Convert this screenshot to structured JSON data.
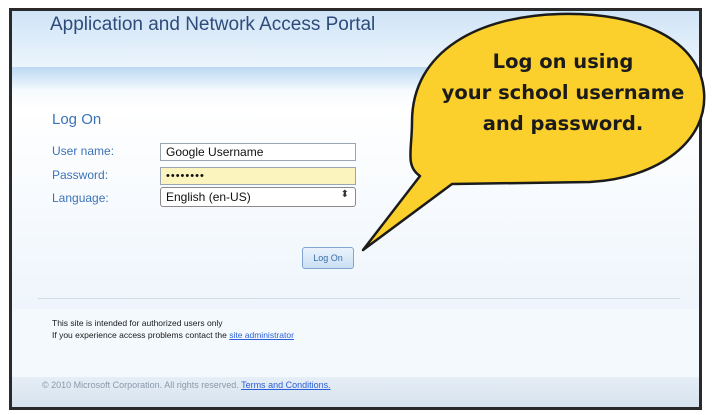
{
  "portal": {
    "title": "Application and Network Access Portal"
  },
  "form": {
    "heading": "Log On",
    "username_label": "User name:",
    "username_value": "Google Username",
    "password_label": "Password:",
    "password_value": "••••••••",
    "language_label": "Language:",
    "language_value": "English (en-US)",
    "submit_label": "Log On"
  },
  "notice": {
    "line1": "This site is intended for authorized users only",
    "line2_prefix": "If you experience access problems contact the ",
    "admin_link": "site administrator"
  },
  "footer": {
    "copyright": "© 2010 Microsoft Corporation. All rights reserved.",
    "terms_link": "Terms and Conditions."
  },
  "callout": {
    "line1": "Log on using",
    "line2": "your school username",
    "line3": "and password."
  },
  "colors": {
    "callout_fill": "#fcd02c",
    "label_blue": "#3b73b7",
    "title_navy": "#2f4b7a",
    "password_fill": "#fbf4bf"
  }
}
